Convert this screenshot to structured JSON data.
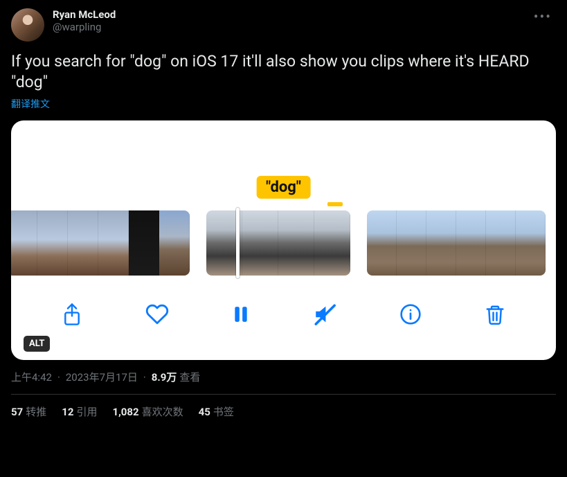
{
  "header": {
    "display_name": "Ryan McLeod",
    "handle": "@warpling"
  },
  "tweet_text": "If you search for \"dog\" on iOS 17 it'll also show you clips where it's HEARD \"dog\"",
  "translate_label": "翻译推文",
  "media": {
    "caption_bubble": "\"dog\"",
    "alt_badge": "ALT"
  },
  "meta": {
    "time": "上午4:42",
    "date": "2023年7月17日",
    "views_count": "8.9万",
    "views_label": "查看"
  },
  "stats": {
    "retweets_count": "57",
    "retweets_label": "转推",
    "quotes_count": "12",
    "quotes_label": "引用",
    "likes_count": "1,082",
    "likes_label": "喜欢次数",
    "bookmarks_count": "45",
    "bookmarks_label": "书签"
  }
}
